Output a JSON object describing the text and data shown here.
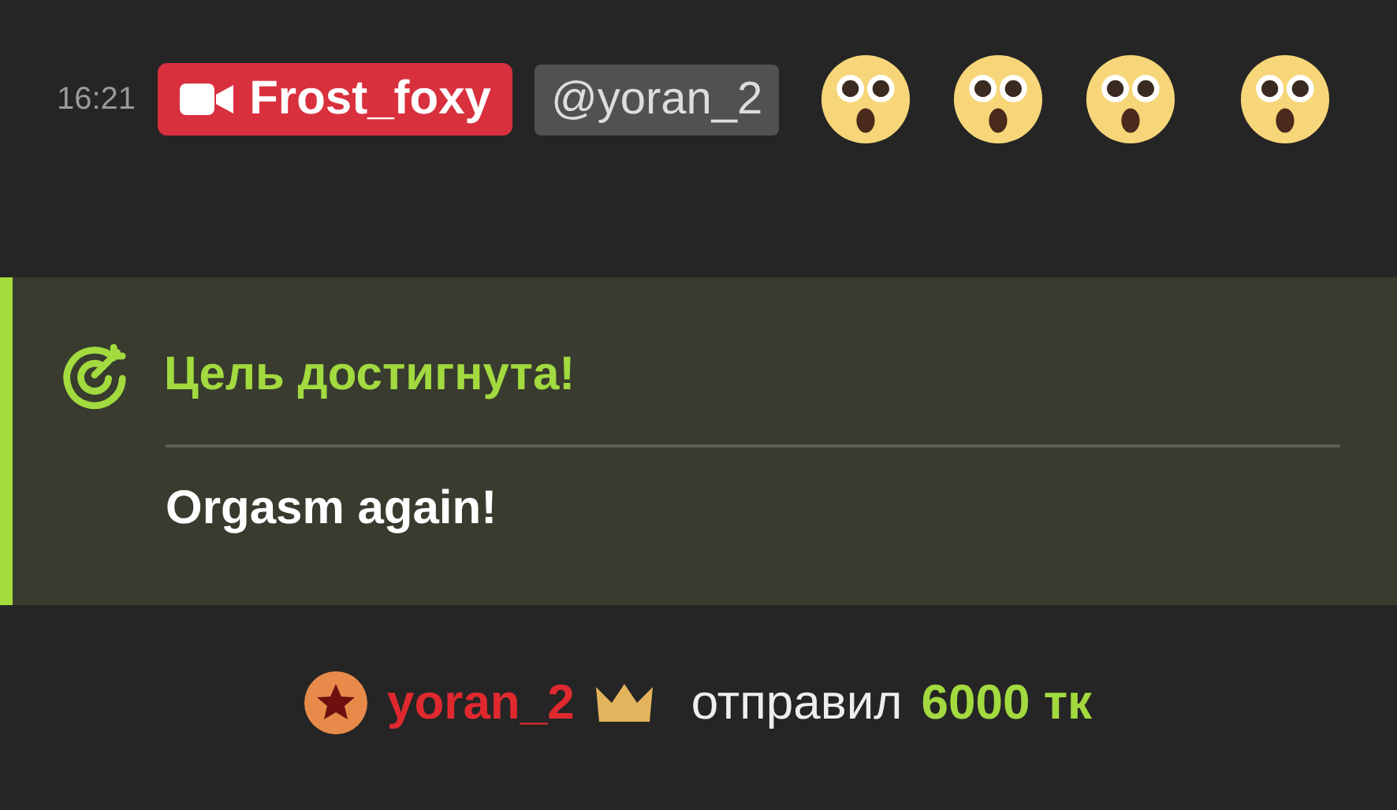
{
  "message": {
    "time": "16:21",
    "sender": "Frost_foxy",
    "mention": "@yoran_2",
    "emojis": [
      {
        "kind": "astonished"
      },
      {
        "kind": "astonished"
      },
      {
        "kind": "astonished"
      },
      {
        "kind": "astonished"
      }
    ]
  },
  "goal": {
    "title": "Цель достигнута!",
    "text": "Orgasm again!"
  },
  "tip": {
    "user": "yoran_2",
    "action": "отправил",
    "amount": "6000 тк"
  }
}
